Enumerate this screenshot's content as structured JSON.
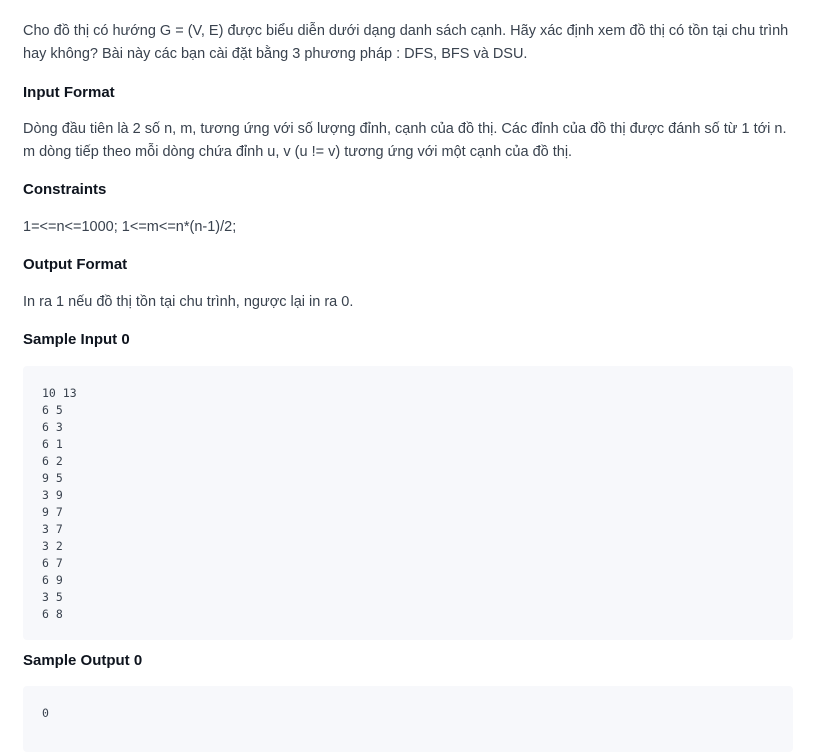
{
  "description": "Cho đồ thị có hướng G = (V, E) được biểu diễn dưới dạng danh sách cạnh. Hãy xác định xem đồ thị có tồn tại chu trình hay không? Bài này các bạn cài đặt bằng 3 phương pháp : DFS, BFS và DSU.",
  "input_format": {
    "heading": "Input Format",
    "text": "Dòng đầu tiên là 2 số n, m, tương ứng với số lượng đỉnh, cạnh của đồ thị. Các đỉnh của đồ thị được đánh số từ 1 tới n. m dòng tiếp theo mỗi dòng chứa đỉnh u, v (u != v) tương ứng với một cạnh của đồ thị."
  },
  "constraints": {
    "heading": "Constraints",
    "text": "1=<=n<=1000; 1<=m<=n*(n-1)/2;"
  },
  "output_format": {
    "heading": "Output Format",
    "text": "In ra 1 nếu đồ thị tồn tại chu trình, ngược lại in ra 0."
  },
  "sample_input": {
    "heading": "Sample Input 0",
    "lines": [
      "10 13",
      "6 5",
      "6 3",
      "6 1",
      "6 2",
      "9 5",
      "3 9",
      "9 7",
      "3 7",
      "3 2",
      "6 7",
      "6 9",
      "3 5",
      "6 8"
    ]
  },
  "sample_output": {
    "heading": "Sample Output 0",
    "lines": [
      "0"
    ]
  }
}
